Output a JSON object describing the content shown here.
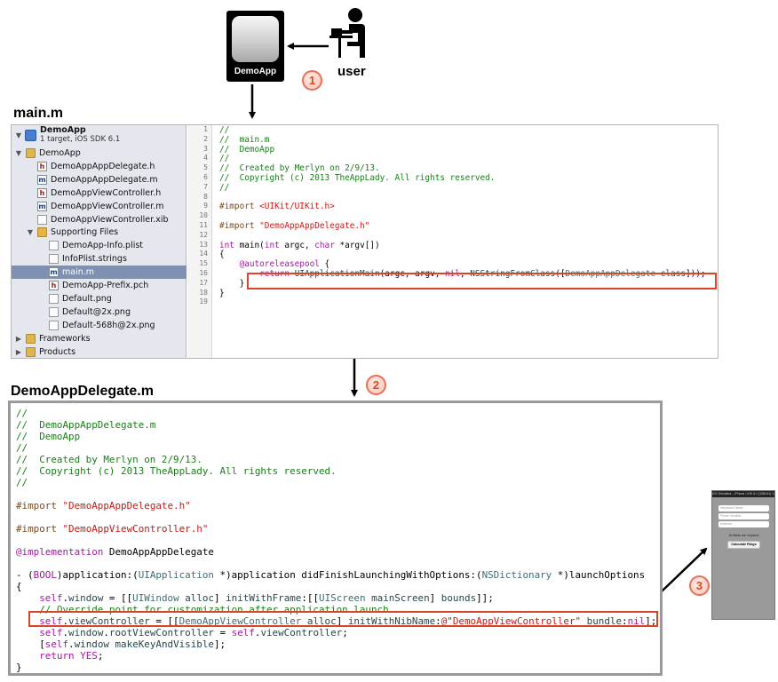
{
  "app_icon": {
    "name": "DemoApp"
  },
  "user": {
    "label": "user"
  },
  "steps": [
    "1",
    "2",
    "3"
  ],
  "section1": {
    "title": "main.m"
  },
  "navigator": {
    "project_name": "DemoApp",
    "project_sub": "1 target, iOS SDK 6.1",
    "items": [
      {
        "label": "DemoApp",
        "icon": "folder-icon",
        "expanded": true
      },
      {
        "label": "DemoAppAppDelegate.h",
        "icon": "header-file-icon"
      },
      {
        "label": "DemoAppAppDelegate.m",
        "icon": "implementation-file-icon"
      },
      {
        "label": "DemoAppViewController.h",
        "icon": "header-file-icon"
      },
      {
        "label": "DemoAppViewController.m",
        "icon": "implementation-file-icon"
      },
      {
        "label": "DemoAppViewController.xib",
        "icon": "xib-file-icon"
      },
      {
        "label": "Supporting Files",
        "icon": "folder-icon",
        "expanded": true
      },
      {
        "label": "DemoApp-Info.plist",
        "icon": "plist-file-icon"
      },
      {
        "label": "InfoPlist.strings",
        "icon": "strings-file-icon"
      },
      {
        "label": "main.m",
        "icon": "implementation-file-icon",
        "selected": true
      },
      {
        "label": "DemoApp-Prefix.pch",
        "icon": "header-file-icon"
      },
      {
        "label": "Default.png",
        "icon": "image-file-icon"
      },
      {
        "label": "Default@2x.png",
        "icon": "image-file-icon"
      },
      {
        "label": "Default-568h@2x.png",
        "icon": "image-file-icon"
      },
      {
        "label": "Frameworks",
        "icon": "folder-icon",
        "expanded": false
      },
      {
        "label": "Products",
        "icon": "folder-icon",
        "expanded": false
      }
    ]
  },
  "main_code": {
    "line_numbers": [
      "1",
      "2",
      "3",
      "4",
      "5",
      "6",
      "7",
      "8",
      "9",
      "10",
      "11",
      "12",
      "13",
      "14",
      "15",
      "16",
      "17",
      "18",
      "19"
    ],
    "lines": [
      [
        {
          "t": "//",
          "c": "com"
        }
      ],
      [
        {
          "t": "//  main.m",
          "c": "com"
        }
      ],
      [
        {
          "t": "//  DemoApp",
          "c": "com"
        }
      ],
      [
        {
          "t": "//",
          "c": "com"
        }
      ],
      [
        {
          "t": "//  Created by Merlyn on 2/9/13.",
          "c": "com"
        }
      ],
      [
        {
          "t": "//  Copyright (c) 2013 TheAppLady. All rights reserved.",
          "c": "com"
        }
      ],
      [
        {
          "t": "//",
          "c": "com"
        }
      ],
      [],
      [
        {
          "t": "#import ",
          "c": "pre"
        },
        {
          "t": "<UIKit/UIKit.h>",
          "c": "str"
        }
      ],
      [],
      [
        {
          "t": "#import ",
          "c": "pre"
        },
        {
          "t": "\"DemoAppAppDelegate.h\"",
          "c": "str"
        }
      ],
      [],
      [
        {
          "t": "int",
          "c": "kw"
        },
        {
          "t": " main("
        },
        {
          "t": "int",
          "c": "kw"
        },
        {
          "t": " argc, "
        },
        {
          "t": "char",
          "c": "kw"
        },
        {
          "t": " *argv[])"
        }
      ],
      [
        {
          "t": "{"
        }
      ],
      [
        {
          "t": "    "
        },
        {
          "t": "@autoreleasepool",
          "c": "at"
        },
        {
          "t": " {"
        }
      ],
      [
        {
          "t": "        "
        },
        {
          "t": "return",
          "c": "kw"
        },
        {
          "t": " "
        },
        {
          "t": "UIApplicationMain",
          "c": "mth"
        },
        {
          "t": "(argc, argv, "
        },
        {
          "t": "nil",
          "c": "kw"
        },
        {
          "t": ", "
        },
        {
          "t": "NSStringFromClass",
          "c": "mth"
        },
        {
          "t": "(["
        },
        {
          "t": "DemoAppAppDelegate",
          "c": "cls"
        },
        {
          "t": " "
        },
        {
          "t": "class",
          "c": "mth"
        },
        {
          "t": "]));"
        }
      ],
      [
        {
          "t": "    }"
        }
      ],
      [
        {
          "t": "}"
        }
      ],
      []
    ]
  },
  "section2": {
    "title": "DemoAppDelegate.m"
  },
  "delegate_code": {
    "lines": [
      [
        {
          "t": "//",
          "c": "com"
        }
      ],
      [
        {
          "t": "//  DemoAppAppDelegate.m",
          "c": "com"
        }
      ],
      [
        {
          "t": "//  DemoApp",
          "c": "com"
        }
      ],
      [
        {
          "t": "//",
          "c": "com"
        }
      ],
      [
        {
          "t": "//  Created by Merlyn on 2/9/13.",
          "c": "com"
        }
      ],
      [
        {
          "t": "//  Copyright (c) 2013 TheAppLady. All rights reserved.",
          "c": "com"
        }
      ],
      [
        {
          "t": "//",
          "c": "com"
        }
      ],
      [],
      [
        {
          "t": "#import ",
          "c": "pre"
        },
        {
          "t": "\"DemoAppAppDelegate.h\"",
          "c": "str"
        }
      ],
      [],
      [
        {
          "t": "#import ",
          "c": "pre"
        },
        {
          "t": "\"DemoAppViewController.h\"",
          "c": "str"
        }
      ],
      [],
      [
        {
          "t": "@implementation",
          "c": "at"
        },
        {
          "t": " DemoAppAppDelegate"
        }
      ],
      [],
      [
        {
          "t": "- ("
        },
        {
          "t": "BOOL",
          "c": "kw"
        },
        {
          "t": ")application:("
        },
        {
          "t": "UIApplication",
          "c": "cls"
        },
        {
          "t": " *)application didFinishLaunchingWithOptions:("
        },
        {
          "t": "NSDictionary",
          "c": "cls"
        },
        {
          "t": " *)launchOptions"
        }
      ],
      [
        {
          "t": "{"
        }
      ],
      [
        {
          "t": "    "
        },
        {
          "t": "self",
          "c": "kw"
        },
        {
          "t": "."
        },
        {
          "t": "window",
          "c": "mth"
        },
        {
          "t": " = [["
        },
        {
          "t": "UIWindow",
          "c": "cls"
        },
        {
          "t": " "
        },
        {
          "t": "alloc",
          "c": "mth"
        },
        {
          "t": "] "
        },
        {
          "t": "initWithFrame",
          "c": "mth"
        },
        {
          "t": ":[["
        },
        {
          "t": "UIScreen",
          "c": "cls"
        },
        {
          "t": " "
        },
        {
          "t": "mainScreen",
          "c": "mth"
        },
        {
          "t": "] "
        },
        {
          "t": "bounds",
          "c": "mth"
        },
        {
          "t": "]];"
        }
      ],
      [
        {
          "t": "    "
        },
        {
          "t": "// Override point for customization after application launch.",
          "c": "com"
        }
      ],
      [
        {
          "t": "    "
        },
        {
          "t": "self",
          "c": "kw"
        },
        {
          "t": "."
        },
        {
          "t": "viewController",
          "c": "mth"
        },
        {
          "t": " = [["
        },
        {
          "t": "DemoAppViewController",
          "c": "cls"
        },
        {
          "t": " "
        },
        {
          "t": "alloc",
          "c": "mth"
        },
        {
          "t": "] "
        },
        {
          "t": "initWithNibName",
          "c": "mth"
        },
        {
          "t": ":"
        },
        {
          "t": "@\"DemoAppViewController\"",
          "c": "str"
        },
        {
          "t": " "
        },
        {
          "t": "bundle",
          "c": "mth"
        },
        {
          "t": ":"
        },
        {
          "t": "nil",
          "c": "kw"
        },
        {
          "t": "];"
        }
      ],
      [
        {
          "t": "    "
        },
        {
          "t": "self",
          "c": "kw"
        },
        {
          "t": "."
        },
        {
          "t": "window",
          "c": "mth"
        },
        {
          "t": "."
        },
        {
          "t": "rootViewController",
          "c": "mth"
        },
        {
          "t": " = "
        },
        {
          "t": "self",
          "c": "kw"
        },
        {
          "t": "."
        },
        {
          "t": "viewController",
          "c": "mth"
        },
        {
          "t": ";"
        }
      ],
      [
        {
          "t": "    ["
        },
        {
          "t": "self",
          "c": "kw"
        },
        {
          "t": "."
        },
        {
          "t": "window",
          "c": "mth"
        },
        {
          "t": " "
        },
        {
          "t": "makeKeyAndVisible",
          "c": "mth"
        },
        {
          "t": "];"
        }
      ],
      [
        {
          "t": "    "
        },
        {
          "t": "return",
          "c": "kw"
        },
        {
          "t": " "
        },
        {
          "t": "YES",
          "c": "kw"
        },
        {
          "t": ";"
        }
      ],
      [
        {
          "t": "}"
        }
      ]
    ]
  },
  "phone": {
    "status": "iOS Simulator – iPhone / iOS 6.1 (10B141)  1:24 PM",
    "fields": [
      "Hardware Name",
      "Phone Number",
      "Address"
    ],
    "note": "All fields are required",
    "button": "Calculate Rings"
  },
  "colors": {
    "highlight": "#d9442b",
    "badge": "#e8705a",
    "comment": "#1a7e1a",
    "string": "#c41a16",
    "keyword": "#a019a0",
    "selection": "#7d91b3"
  }
}
